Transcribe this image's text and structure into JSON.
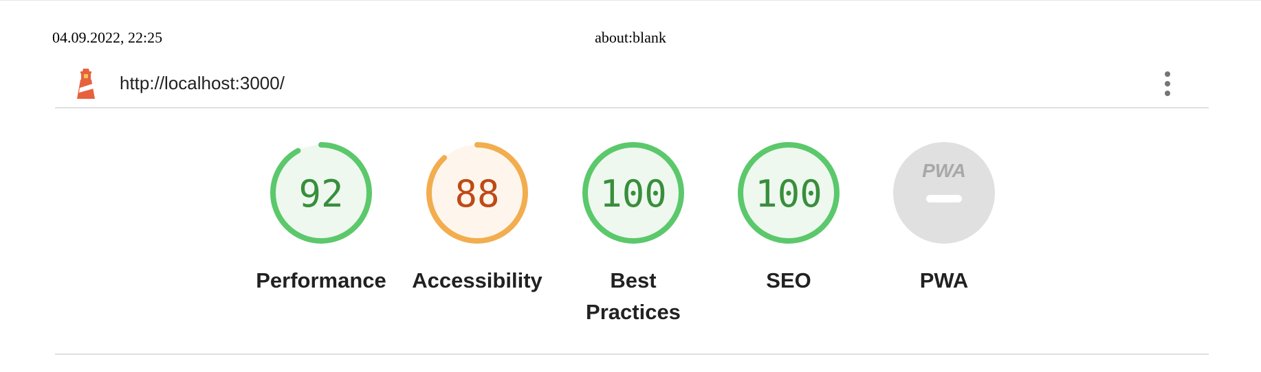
{
  "print_header": {
    "datetime": "04.09.2022, 22:25",
    "title": "about:blank"
  },
  "topbar": {
    "logo_icon": "lighthouse-icon",
    "url": "http://localhost:3000/",
    "menu_icon": "more-vert-icon"
  },
  "gauges": [
    {
      "label": "Performance",
      "score": "92",
      "fraction": 0.92,
      "rating": "pass",
      "color": "#5bc86b",
      "fill": "#eef8ef",
      "text_color": "#388e3c"
    },
    {
      "label": "Accessibility",
      "score": "88",
      "fraction": 0.88,
      "rating": "average",
      "color": "#f2ad4e",
      "fill": "#fef6ec",
      "text_color": "#bf4a17"
    },
    {
      "label": "Best Practices",
      "score": "100",
      "fraction": 1.0,
      "rating": "pass",
      "color": "#5bc86b",
      "fill": "#eef8ef",
      "text_color": "#388e3c"
    },
    {
      "label": "SEO",
      "score": "100",
      "fraction": 1.0,
      "rating": "pass",
      "color": "#5bc86b",
      "fill": "#eef8ef",
      "text_color": "#388e3c"
    },
    {
      "label": "PWA",
      "badge_text": "PWA",
      "rating": "na",
      "fill": "#e0e0e0",
      "text_color": "#a8a8a8"
    }
  ]
}
